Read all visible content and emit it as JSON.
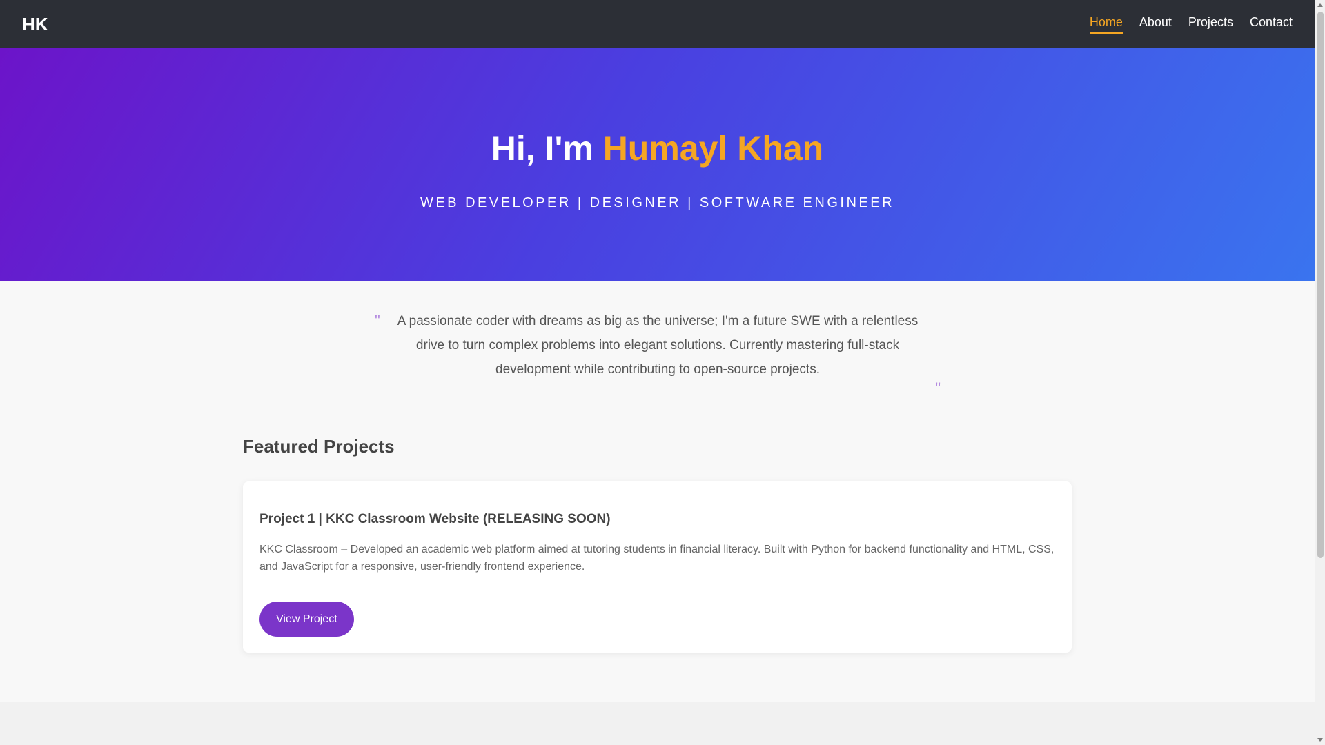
{
  "nav": {
    "logo": "HK",
    "links": [
      {
        "label": "Home",
        "active": true
      },
      {
        "label": "About",
        "active": false
      },
      {
        "label": "Projects",
        "active": false
      },
      {
        "label": "Contact",
        "active": false
      }
    ]
  },
  "hero": {
    "greeting": "Hi, I'm",
    "name": "Humayl Khan",
    "subtitle": "WEB DEVELOPER | DESIGNER | SOFTWARE ENGINEER"
  },
  "quote": {
    "open_mark": "\"",
    "close_mark": "\"",
    "text": "A passionate coder with dreams as big as the universe; I'm a future SWE with a relentless drive to turn complex problems into elegant solutions. Currently mastering full-stack development while contributing to open-source projects."
  },
  "projects": {
    "section_title": "Featured Projects",
    "items": [
      {
        "title": "Project 1 | KKC Classroom Website (RELEASING SOON)",
        "description": "KKC Classroom – Developed an academic web platform aimed at tutoring students in financial literacy. Built with Python for backend functionality and HTML, CSS, and JavaScript for a responsive, user-friendly frontend experience.",
        "button_label": "View Project"
      }
    ]
  },
  "colors": {
    "nav_bg": "#2c2f36",
    "accent": "#f5a623",
    "button": "#7b35c9",
    "hero_gradient_start": "#6c14c9",
    "hero_gradient_end": "#3a74ef"
  }
}
